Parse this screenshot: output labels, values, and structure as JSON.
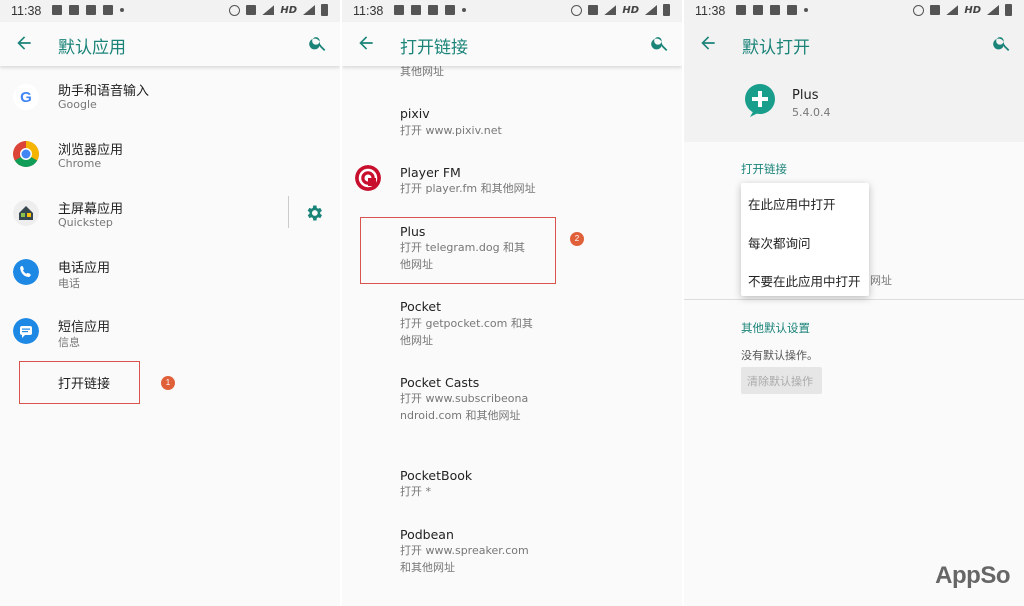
{
  "status": {
    "time": "11:38",
    "network": "HD"
  },
  "panel1": {
    "title": "默认应用",
    "items": [
      {
        "title": "助手和语音输入",
        "subtitle": "Google"
      },
      {
        "title": "浏览器应用",
        "subtitle": "Chrome"
      },
      {
        "title": "主屏幕应用",
        "subtitle": "Quickstep"
      },
      {
        "title": "电话应用",
        "subtitle": "电话"
      },
      {
        "title": "短信应用",
        "subtitle": "信息"
      }
    ],
    "open_links": "打开链接",
    "badge": "1"
  },
  "panel2": {
    "title": "打开链接",
    "top_partial": "其他网址",
    "items": [
      {
        "title": "pixiv",
        "subtitle": "打开 www.pixiv.net"
      },
      {
        "title": "Player FM",
        "subtitle": "打开 player.fm 和其他网址"
      },
      {
        "title": "Plus",
        "subtitle": "打开 telegram.dog 和其他网址"
      },
      {
        "title": "Pocket",
        "subtitle": "打开 getpocket.com 和其他网址"
      },
      {
        "title": "Pocket Casts",
        "subtitle": "打开 www.subscribeonandroid.com 和其他网址"
      },
      {
        "title": "PocketBook",
        "subtitle": "打开 *"
      },
      {
        "title": "Podbean",
        "subtitle": "打开 www.spreaker.com 和其他网址"
      }
    ],
    "badge": "2"
  },
  "panel3": {
    "title": "默认打开",
    "app_name": "Plus",
    "app_version": "5.4.0.4",
    "section_open_links": "打开链接",
    "menu": [
      "在此应用中打开",
      "每次都询问",
      "不要在此应用中打开"
    ],
    "behind_text": "网址",
    "section_other": "其他默认设置",
    "no_defaults": "没有默认操作。",
    "clear_button": "清除默认操作"
  },
  "watermark": "AppSo",
  "colors": {
    "accent": "#1b8479",
    "highlight": "#d9534f",
    "badge": "#e0603a"
  }
}
